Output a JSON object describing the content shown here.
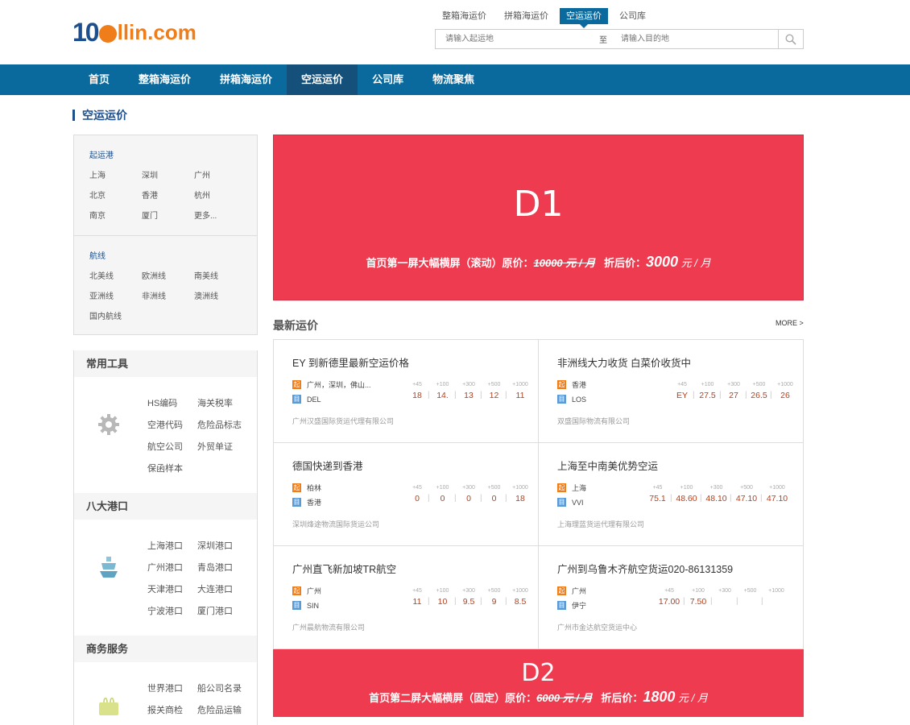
{
  "logo": {
    "part1": "10",
    "part2": "llin.com"
  },
  "top_tabs": [
    "整箱海运价",
    "拼箱海运价",
    "空运运价",
    "公司库"
  ],
  "top_tab_active": 2,
  "search": {
    "from_placeholder": "请输入起运地",
    "separator": "至",
    "to_placeholder": "请输入目的地"
  },
  "nav": [
    "首页",
    "整箱海运价",
    "拼箱海运价",
    "空运运价",
    "公司库",
    "物流聚焦"
  ],
  "page_title": "空运运价",
  "filters": {
    "ports_head": "起运港",
    "ports": [
      "上海",
      "深圳",
      "广州",
      "北京",
      "香港",
      "杭州",
      "南京",
      "厦门",
      "更多..."
    ],
    "routes_head": "航线",
    "routes": [
      "北美线",
      "欧洲线",
      "南美线",
      "亚洲线",
      "非洲线",
      "澳洲线",
      "国内航线"
    ]
  },
  "tools": {
    "common_head": "常用工具",
    "common": [
      "HS编码",
      "海关税率",
      "空港代码",
      "危险品标志",
      "航空公司",
      "外贸单证",
      "保函样本"
    ],
    "ports_head": "八大港口",
    "ports": [
      "上海港口",
      "深圳港口",
      "广州港口",
      "青岛港口",
      "天津港口",
      "大连港口",
      "宁波港口",
      "厦门港口"
    ],
    "biz_head": "商务服务",
    "biz": [
      "世界港口",
      "船公司名录",
      "报关商检",
      "危险品运输"
    ]
  },
  "banner1": {
    "label": "D1",
    "desc": "首页第一屏大幅横屏（滚动）原价：",
    "orig": "10000 元 / 月",
    "disc_label": "折后价：",
    "price": "3000",
    "unit": "元 / 月"
  },
  "banner2": {
    "label": "D2",
    "desc": "首页第二屏大幅横屏（固定）原价：",
    "orig": "6000 元 / 月",
    "disc_label": "折后价：",
    "price": "1800",
    "unit": "元 / 月"
  },
  "latest": {
    "title": "最新运价",
    "more": "MORE >"
  },
  "rate_tags": {
    "origin": "起",
    "dest": "目"
  },
  "rate_headers": [
    "+45",
    "+100",
    "+300",
    "+500",
    "+1000"
  ],
  "rates": [
    {
      "title": "EY 到新德里最新空运价格",
      "origin": "广州，深圳，佛山...",
      "dest": "DEL",
      "prices": [
        "18",
        "14.",
        "13",
        "12",
        "11"
      ],
      "company": "广州汉盛国际货运代理有限公司"
    },
    {
      "title": "非洲线大力收货 白菜价收货中",
      "origin": "香港",
      "dest": "LOS",
      "prices": [
        "EY",
        "27.5",
        "27",
        "26.5",
        "26"
      ],
      "company": "双盛国际物流有限公司"
    },
    {
      "title": "德国快递到香港",
      "origin": "柏林",
      "dest": "香港",
      "prices": [
        "0",
        "0",
        "0",
        "0",
        "18"
      ],
      "company": "深圳烽途物流国际货运公司"
    },
    {
      "title": "上海至中南美优势空运",
      "origin": "上海",
      "dest": "VVI",
      "prices": [
        "75.1",
        "48.60",
        "48.10",
        "47.10",
        "47.10"
      ],
      "company": "上海理蓝货运代理有限公司"
    },
    {
      "title": "广州直飞新加坡TR航空",
      "origin": "广州",
      "dest": "SIN",
      "prices": [
        "11",
        "10",
        "9.5",
        "9",
        "8.5"
      ],
      "company": "广州晨航物流有限公司"
    },
    {
      "title": "广州到乌鲁木齐航空货运020-86131359",
      "origin": "广州",
      "dest": "伊宁",
      "prices": [
        "17.00",
        "7.50",
        "",
        "",
        ""
      ],
      "company": "广州市金达航空货运中心"
    }
  ],
  "colors": {
    "brand_blue": "#0a6a9e",
    "banner_red": "#ef3b4f",
    "price_red": "#b5411e",
    "logo_orange": "#ef7d1a"
  }
}
